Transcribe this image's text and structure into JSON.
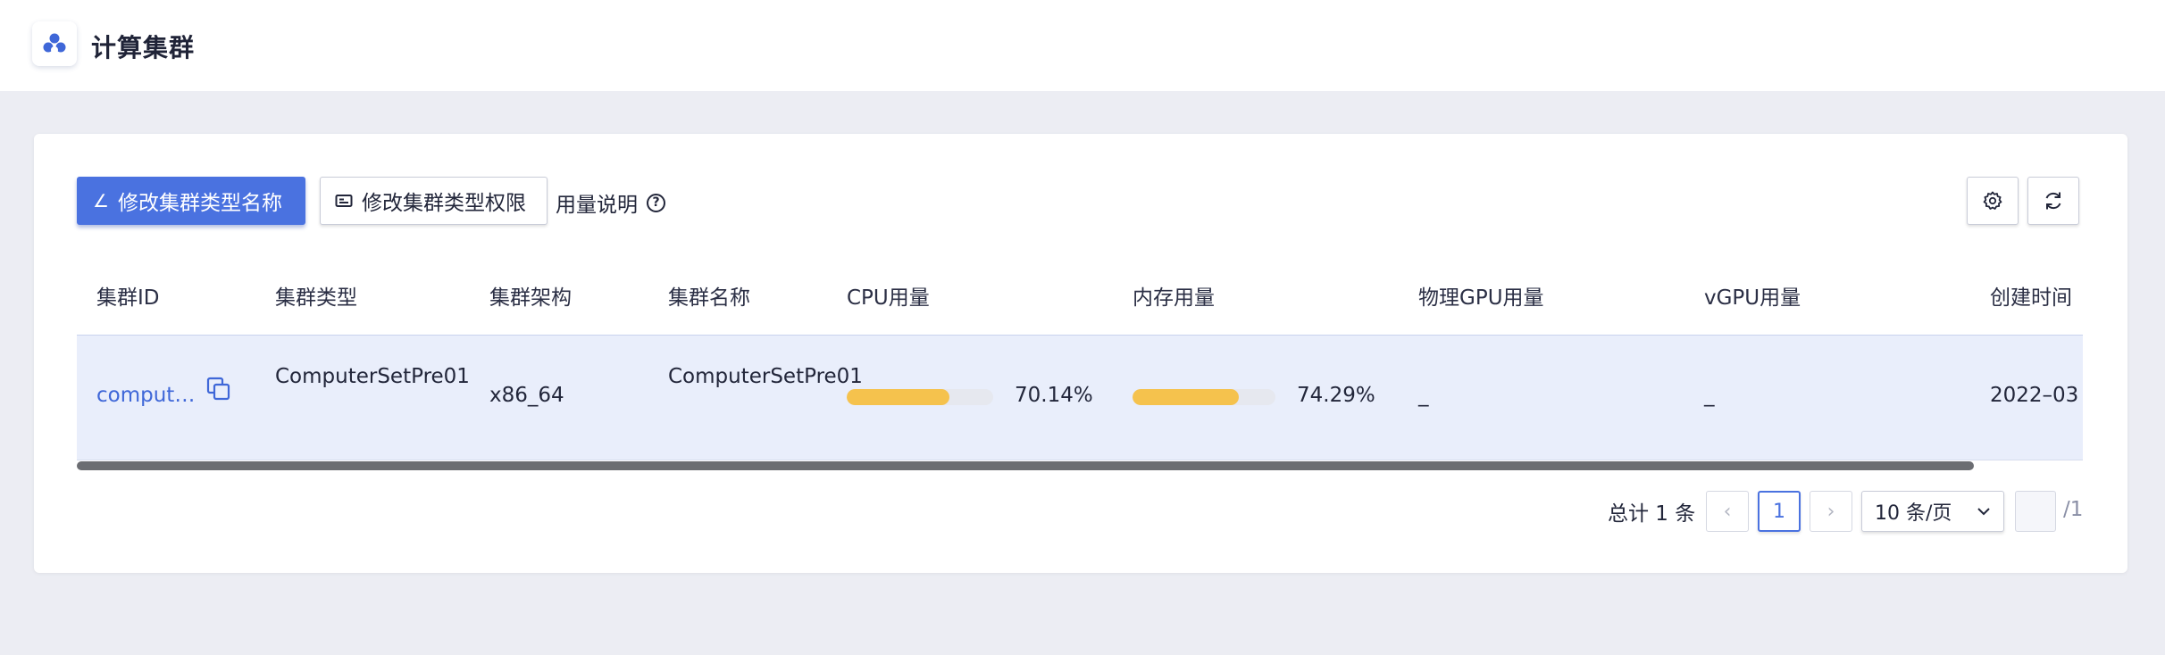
{
  "header": {
    "title": "计算集群",
    "logo_icon": "cluster-icon"
  },
  "toolbar": {
    "rename_label": "修改集群类型名称",
    "permission_label": "修改集群类型权限",
    "usage_note": "用量说明",
    "help_icon": "?",
    "settings_icon": "gear-icon",
    "refresh_icon": "refresh-icon",
    "primary_color": "#4a72e0"
  },
  "table": {
    "columns": [
      "集群ID",
      "集群类型",
      "集群架构",
      "集群名称",
      "CPU用量",
      "内存用量",
      "物理GPU用量",
      "vGPU用量",
      "创建时间"
    ],
    "rows": [
      {
        "id": "comput…",
        "type": "ComputerSetPre01",
        "arch": "x86_64",
        "name": "ComputerSetPre01",
        "cpu_label": "70.14%",
        "cpu_fraction": 0.7014,
        "mem_label": "74.29%",
        "mem_fraction": 0.7429,
        "gpu": "_",
        "vgpu": "_",
        "created": "2022–03"
      }
    ],
    "bar_color": "#f5c24d"
  },
  "pagination": {
    "total": "总计 1 条",
    "prev": "‹",
    "current": "1",
    "next": "›",
    "page_size": "10 条/页",
    "jump_value": "",
    "of_pages": "/1"
  }
}
